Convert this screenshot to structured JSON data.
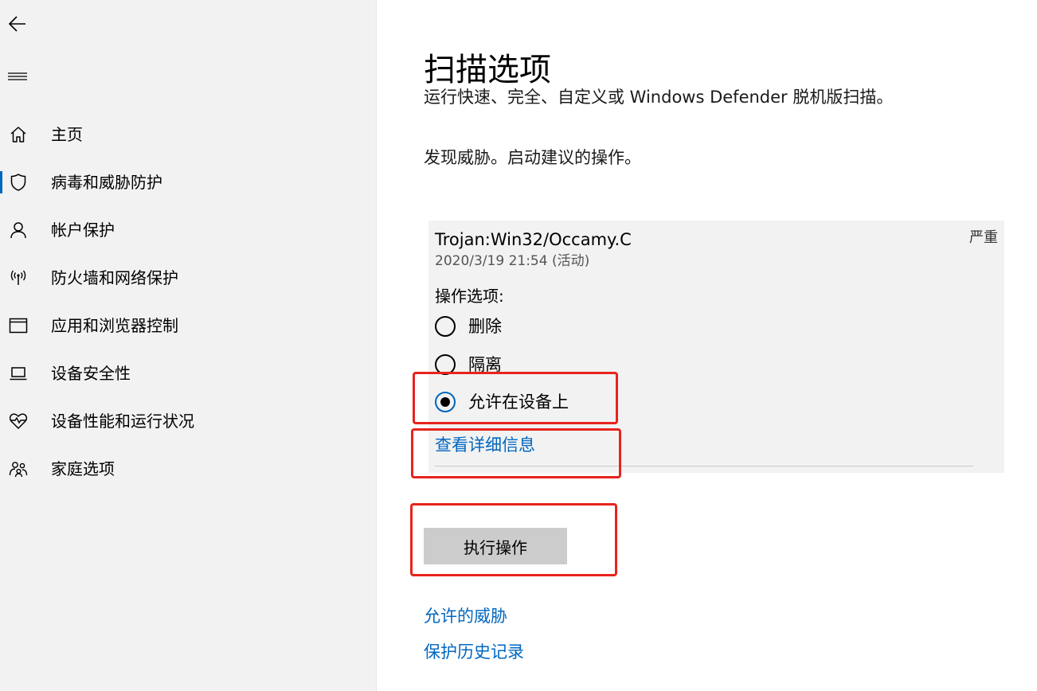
{
  "sidebar": {
    "back_icon": "back-arrow-icon",
    "menu_icon": "hamburger-menu-icon",
    "items": [
      {
        "label": "主页",
        "icon": "home-icon",
        "active": false
      },
      {
        "label": "病毒和威胁防护",
        "icon": "shield-icon",
        "active": true
      },
      {
        "label": "帐户保护",
        "icon": "person-icon",
        "active": false
      },
      {
        "label": "防火墙和网络保护",
        "icon": "wifi-antenna-icon",
        "active": false
      },
      {
        "label": "应用和浏览器控制",
        "icon": "browser-window-icon",
        "active": false
      },
      {
        "label": "设备安全性",
        "icon": "laptop-icon",
        "active": false
      },
      {
        "label": "设备性能和运行状况",
        "icon": "heart-pulse-icon",
        "active": false
      },
      {
        "label": "家庭选项",
        "icon": "family-icon",
        "active": false
      }
    ]
  },
  "main": {
    "title": "扫描选项",
    "subtitle": "运行快速、完全、自定义或 Windows Defender 脱机版扫描。",
    "threat_message": "发现威胁。启动建议的操作。",
    "threat": {
      "name": "Trojan:Win32/Occamy.C",
      "severity": "严重",
      "date": "2020/3/19 21:54 (活动)",
      "actions_label": "操作选项:",
      "options": [
        {
          "label": "删除",
          "selected": false
        },
        {
          "label": "隔离",
          "selected": false
        },
        {
          "label": "允许在设备上",
          "selected": true
        }
      ],
      "details_link": "查看详细信息"
    },
    "action_button": "执行操作",
    "links": {
      "allowed_threats": "允许的威胁",
      "protection_history": "保护历史记录"
    }
  },
  "colors": {
    "accent": "#0067c0",
    "annotation": "#e8231d",
    "sidebar_bg": "#f2f2f2",
    "card_bg": "#f2f2f2",
    "button_bg": "#cccccc"
  }
}
